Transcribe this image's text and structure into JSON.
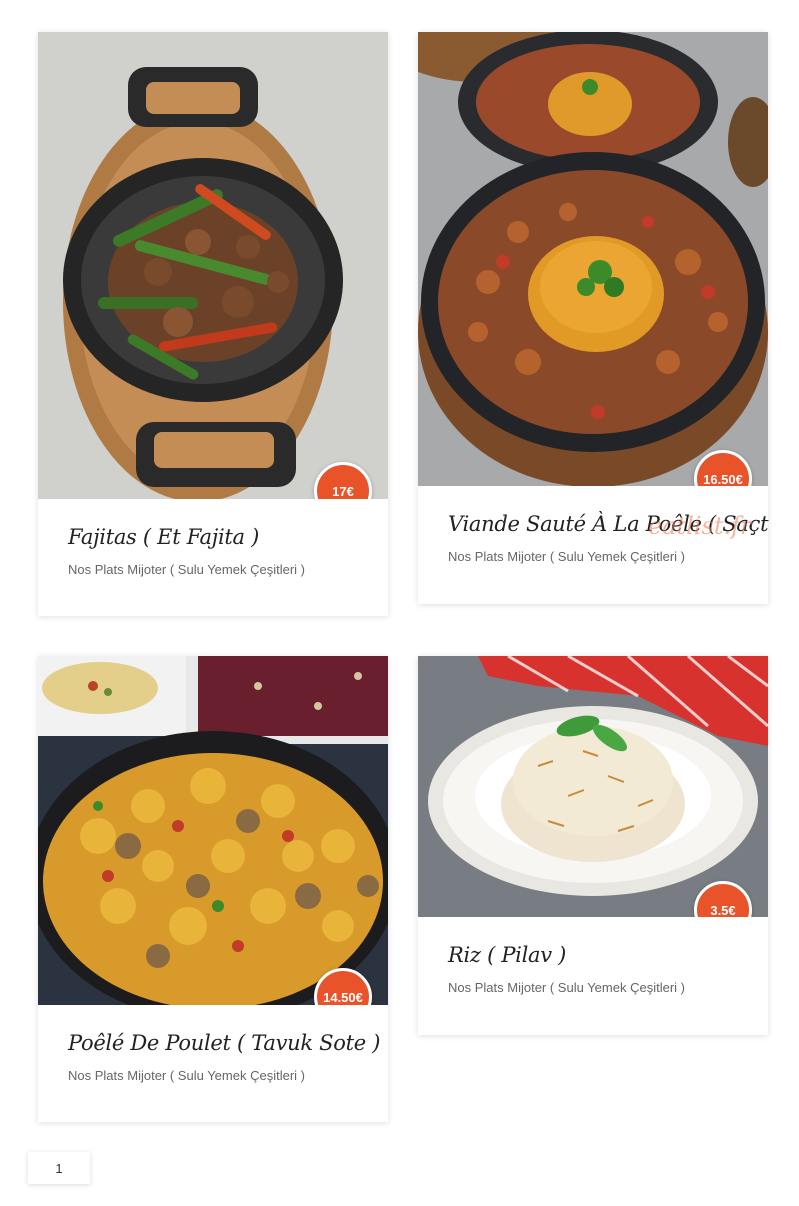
{
  "products": [
    {
      "title": "Fajitas ( Et Fajita )",
      "category": "Nos Plats Mijoter ( Sulu Yemek Çeşitleri )",
      "price": "17€",
      "image_icon": "fajitas-dish-image"
    },
    {
      "title": "Viande Sauté À La Poêle ( Saçt",
      "category": "Nos Plats Mijoter ( Sulu Yemek Çeşitleri )",
      "price": "16.50€",
      "image_icon": "saute-meat-dish-image"
    },
    {
      "title": "Poêlé De Poulet ( Tavuk Sote )",
      "category": "Nos Plats Mijoter ( Sulu Yemek Çeşitleri )",
      "price": "14.50€",
      "image_icon": "chicken-saute-dish-image"
    },
    {
      "title": "Riz ( Pilav )",
      "category": "Nos Plats Mijoter ( Sulu Yemek Çeşitleri )",
      "price": "3.5€",
      "image_icon": "rice-pilaf-dish-image"
    }
  ],
  "watermark": "eatlist.fr",
  "pagination": {
    "current": "1"
  },
  "colors": {
    "accent": "#e8532a",
    "title": "#222222",
    "category": "#666666"
  }
}
